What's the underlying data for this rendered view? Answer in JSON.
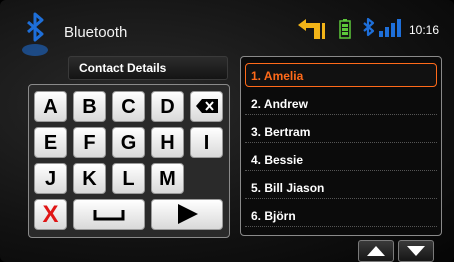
{
  "header": {
    "title": "Bluetooth",
    "time": "10:16",
    "icons": [
      "bluetooth-icon",
      "navigation-turn-icon",
      "battery-icon",
      "signal-strength-icon"
    ]
  },
  "contact_field": {
    "label": "Contact Details"
  },
  "keypad": {
    "row1": [
      "A",
      "B",
      "C",
      "D"
    ],
    "row2": [
      "E",
      "F",
      "G",
      "H",
      "I"
    ],
    "row3": [
      "J",
      "K",
      "L",
      "M"
    ],
    "delete_icon": "backspace-icon",
    "cancel_label": "X",
    "space_icon": "space-icon",
    "enter_icon": "play-arrow-icon"
  },
  "contacts": [
    "1. Amelia",
    "2. Andrew",
    "3. Bertram",
    "4. Bessie",
    "5. Bill Jiason",
    "6. Björn"
  ],
  "colors": {
    "accent": "#ff6a1a",
    "bluetooth": "#1e6fd9",
    "nav_arrow": "#f2b418",
    "battery": "#5cc83a",
    "cancel": "#e01616"
  }
}
